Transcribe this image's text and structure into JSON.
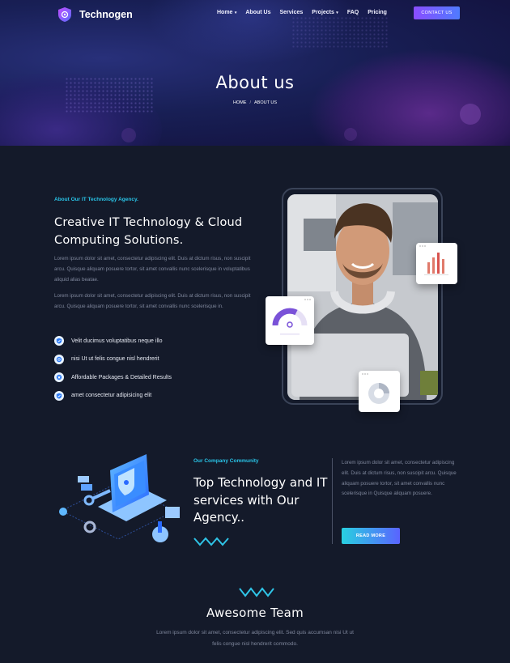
{
  "brand": {
    "name": "Technogen"
  },
  "nav": {
    "items": [
      {
        "label": "Home",
        "dropdown": true
      },
      {
        "label": "About Us",
        "dropdown": false
      },
      {
        "label": "Services",
        "dropdown": false
      },
      {
        "label": "Projects",
        "dropdown": true
      },
      {
        "label": "FAQ",
        "dropdown": false
      },
      {
        "label": "Pricing",
        "dropdown": false
      }
    ],
    "cta": "CONTACT US"
  },
  "hero": {
    "title": "About us",
    "breadcrumb": {
      "home": "HOME",
      "separator": "/",
      "current": "ABOUT US"
    }
  },
  "about": {
    "subtitle": "About Our IT Technology Agency.",
    "title": "Creative IT Technology & Cloud Computing Solutions.",
    "paragraphs": [
      "Lorem ipsum dolor sit amet, consectetur adipiscing elit. Duis at dictum risus, non suscipit arcu. Quisque aliquam posuere tortor, sit amet convallis nunc scelerisque in voluptatibus aliquid alias beatae.",
      "Lorem ipsum dolor sit amet, consectetur adipiscing elit. Duis at dictum risus, non suscipit arcu. Quisque aliquam posuere tortor, sit amet convallis nunc scelerisque in."
    ],
    "features": [
      "Velit ducimus voluptatibus neque illo",
      "nisi Ut ut felis congue nisl hendrerit",
      "Affordable Packages & Detailed Results",
      "amet consectetur adipisicing elit"
    ]
  },
  "community": {
    "subtitle": "Our Company Community",
    "title": "Top Technology and IT services with Our Agency..",
    "paragraph": "Lorem ipsum dolor sit amet, consectetur adipiscing elit. Duis at dictum risus, non suscipit arcu. Quisque aliquam posuere tortor, sit amet convallis nunc scelerisque in Quisque aliquam posuere.",
    "button": "READ MORE"
  },
  "team": {
    "title": "Awesome Team",
    "paragraph": "Lorem ipsum dolor sit amet, consectetur adipiscing elit. Sed quis accumsan nisi Ut ut felis congue nisl hendrerit commodo."
  },
  "colors": {
    "accent_cyan": "#29c3e6",
    "accent_purple": "#8a4dff",
    "background": "#141a2a"
  }
}
